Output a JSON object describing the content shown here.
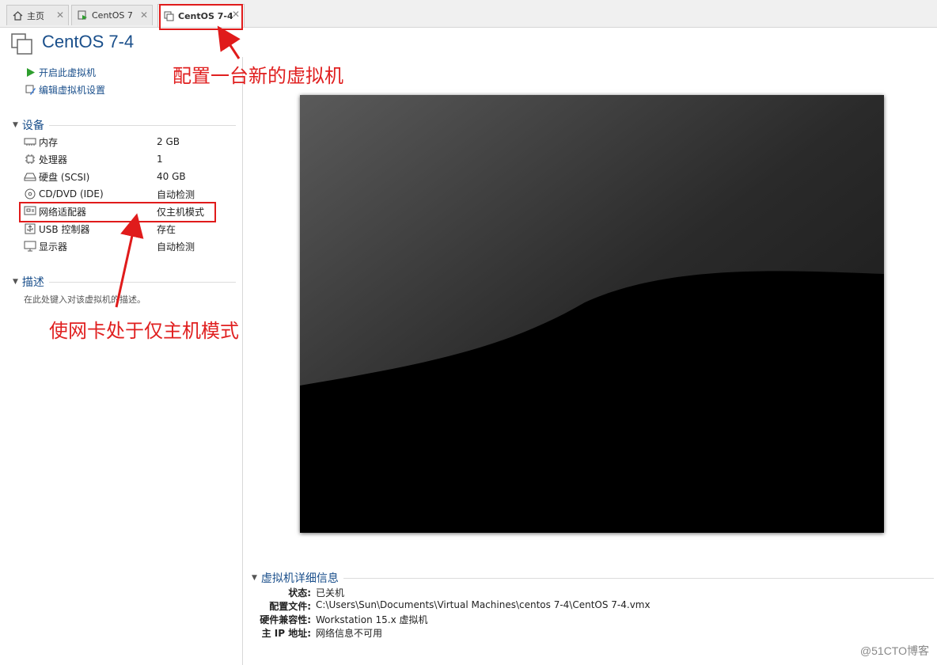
{
  "tabs": [
    {
      "label": "主页",
      "icon": "home-icon",
      "active": false
    },
    {
      "label": "CentOS 7",
      "icon": "vm-running-icon",
      "active": false
    },
    {
      "label": "CentOS 7-4",
      "icon": "vm-icon",
      "active": true
    }
  ],
  "header": {
    "title": "CentOS 7-4"
  },
  "actions": {
    "power_on": "开启此虚拟机",
    "edit_settings": "编辑虚拟机设置"
  },
  "devices": {
    "heading": "设备",
    "items": [
      {
        "name": "内存",
        "value": "2 GB",
        "icon": "memory-icon"
      },
      {
        "name": "处理器",
        "value": "1",
        "icon": "cpu-icon"
      },
      {
        "name": "硬盘 (SCSI)",
        "value": "40 GB",
        "icon": "hard-disk-icon"
      },
      {
        "name": "CD/DVD (IDE)",
        "value": "自动检测",
        "icon": "cd-dvd-icon"
      },
      {
        "name": "网络适配器",
        "value": "仅主机模式",
        "icon": "network-adapter-icon"
      },
      {
        "name": "USB 控制器",
        "value": "存在",
        "icon": "usb-icon"
      },
      {
        "name": "显示器",
        "value": "自动检测",
        "icon": "display-icon"
      }
    ]
  },
  "description": {
    "heading": "描述",
    "placeholder": "在此处键入对该虚拟机的描述。"
  },
  "annotations": {
    "top": "配置一台新的虚拟机",
    "middle": "使网卡处于仅主机模式",
    "color": "#e02020"
  },
  "details": {
    "heading": "虚拟机详细信息",
    "rows": [
      {
        "key": "状态:",
        "value": "已关机"
      },
      {
        "key": "配置文件:",
        "value": "C:\\Users\\Sun\\Documents\\Virtual Machines\\centos 7-4\\CentOS 7-4.vmx"
      },
      {
        "key": "硬件兼容性:",
        "value": "Workstation 15.x 虚拟机"
      },
      {
        "key": "主 IP 地址:",
        "value": "网络信息不可用"
      }
    ]
  },
  "watermark": "@51CTO博客",
  "colors": {
    "accent": "#1a4f8b",
    "annotation": "#e01b1b",
    "play": "#2e9e2e"
  }
}
